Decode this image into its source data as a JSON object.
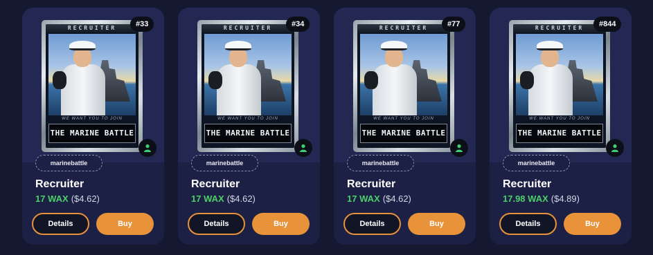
{
  "colors": {
    "page_bg": "#141830",
    "card_bg": "#1c2044",
    "accent_orange": "#e8923a",
    "price_green": "#4bd06a",
    "owner_icon_green": "#3ecf73"
  },
  "cards": [
    {
      "mint": "#33",
      "collection": "marinebattle",
      "name": "Recruiter",
      "price_wax": "17 WAX",
      "price_usd": "($4.62)",
      "details_label": "Details",
      "buy_label": "Buy",
      "nft_header": "RECRUITER",
      "nft_tagline": "WE WANT YOU TO JOIN",
      "nft_title": "THE MARINE BATTLE",
      "owner_icon": "user-icon"
    },
    {
      "mint": "#34",
      "collection": "marinebattle",
      "name": "Recruiter",
      "price_wax": "17 WAX",
      "price_usd": "($4.62)",
      "details_label": "Details",
      "buy_label": "Buy",
      "nft_header": "RECRUITER",
      "nft_tagline": "WE WANT YOU TO JOIN",
      "nft_title": "THE MARINE BATTLE",
      "owner_icon": "user-icon"
    },
    {
      "mint": "#77",
      "collection": "marinebattle",
      "name": "Recruiter",
      "price_wax": "17 WAX",
      "price_usd": "($4.62)",
      "details_label": "Details",
      "buy_label": "Buy",
      "nft_header": "RECRUITER",
      "nft_tagline": "WE WANT YOU TO JOIN",
      "nft_title": "THE MARINE BATTLE",
      "owner_icon": "user-icon"
    },
    {
      "mint": "#844",
      "collection": "marinebattle",
      "name": "Recruiter",
      "price_wax": "17.98 WAX",
      "price_usd": "($4.89)",
      "details_label": "Details",
      "buy_label": "Buy",
      "nft_header": "RECRUITER",
      "nft_tagline": "WE WANT YOU TO JOIN",
      "nft_title": "THE MARINE BATTLE",
      "owner_icon": "user-icon"
    }
  ]
}
